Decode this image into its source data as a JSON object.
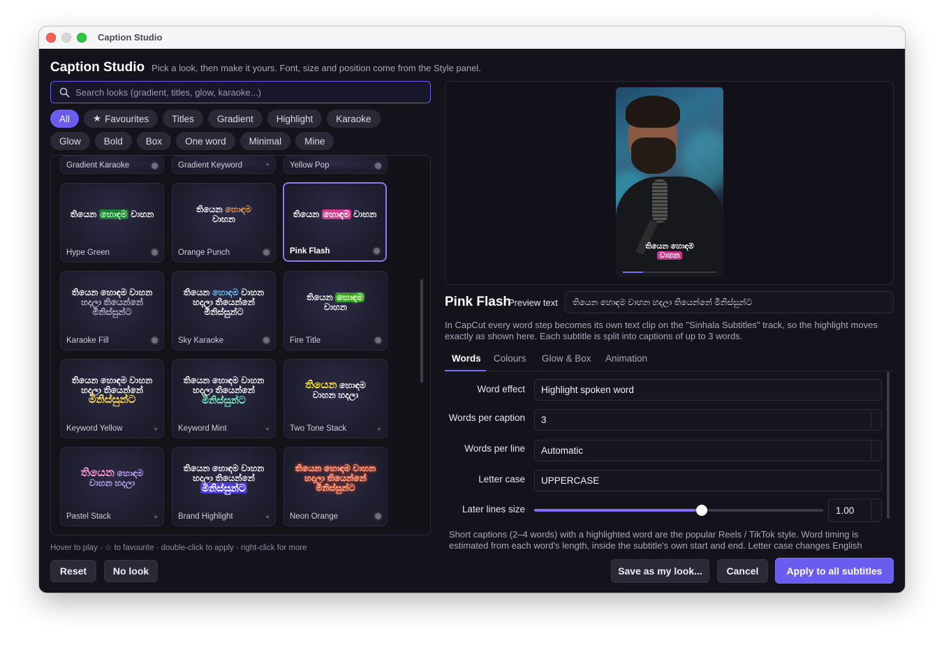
{
  "window": {
    "title": "Caption Studio"
  },
  "header": {
    "title": "Caption Studio",
    "subtitle": "Pick a look, then make it yours. Font, size and position come from the Style panel."
  },
  "search": {
    "placeholder": "Search looks (gradient, titles, glow, karaoke...)"
  },
  "filters": {
    "row1": [
      "All",
      "Favourites",
      "Titles",
      "Gradient",
      "Highlight",
      "Karaoke"
    ],
    "row2": [
      "Glow",
      "Bold",
      "Box",
      "One word",
      "Minimal",
      "Mine"
    ],
    "active": "All"
  },
  "looks": {
    "partial": [
      {
        "name": "Gradient Karaoke",
        "marker": "dot"
      },
      {
        "name": "Gradient Keyword",
        "marker": "+"
      },
      {
        "name": "Yellow Pop",
        "marker": "dot"
      }
    ],
    "items": [
      {
        "name": "Hype Green",
        "sample": "තියෙන හොඳම වාහන",
        "marker": "dot"
      },
      {
        "name": "Orange Punch",
        "sample": "තියෙන හොඳම වාහන",
        "marker": "dot"
      },
      {
        "name": "Pink Flash",
        "sample": "තියෙන හොඳම වාහන",
        "marker": "dot",
        "selected": true
      },
      {
        "name": "Karaoke Fill",
        "sample": "තියෙන හොඳම වාහන හදලා තියෙන්නේ මිනිස්සුන්ට",
        "marker": "dot"
      },
      {
        "name": "Sky Karaoke",
        "sample": "තියෙන හොඳම වාහන හදලා තියෙන්නේ මිනිස්සුන්ට",
        "marker": "dot"
      },
      {
        "name": "Fire Title",
        "sample": "තියෙන හොඳම වාහන",
        "marker": "dot"
      },
      {
        "name": "Keyword Yellow",
        "sample": "තියෙන හොඳම වාහන හදලා තියෙන්නේ මිනිස්සුන්ට",
        "marker": "+"
      },
      {
        "name": "Keyword Mint",
        "sample": "තියෙන හොඳම වාහන හදලා තියෙන්නේ මිනිස්සුන්ට",
        "marker": "+"
      },
      {
        "name": "Two Tone Stack",
        "sample": "තියෙන හොඳම වාහන හදලා",
        "marker": "+"
      },
      {
        "name": "Pastel Stack",
        "sample": "තියෙන හොඳම වාහන හදලා",
        "marker": "+"
      },
      {
        "name": "Brand Highlight",
        "sample": "තියෙන හොඳම වාහන හදලා තියෙන්නේ මිනිස්සුන්ට",
        "marker": "+"
      },
      {
        "name": "Neon Orange",
        "sample": "තියෙන හොඳම වාහන හදලා තියෙන්නේ මිනිස්සුන්ට",
        "marker": "dot"
      }
    ]
  },
  "hint": "Hover to play · ☆ to favourite · double-click to apply · right-click for more",
  "left_buttons": {
    "reset": "Reset",
    "no_look": "No look"
  },
  "preview": {
    "caption_line1": "තියෙන හොඳම",
    "caption_line2": "වාහන",
    "progress": 0.22
  },
  "style": {
    "name": "Pink Flash",
    "preview_text_label": "Preview text",
    "preview_text": "තියෙන හොඳම වාහන හදලා තියෙන්නේ මිනිස්සුන්ට"
  },
  "info": "In CapCut every word step becomes its own text clip on the \"Sinhala Subtitles\" track, so the highlight moves exactly as shown here. Each subtitle is split into captions of up to 3 words.",
  "tabs": [
    "Words",
    "Colours",
    "Glow & Box",
    "Animation"
  ],
  "active_tab": "Words",
  "form": {
    "word_effect": {
      "label": "Word effect",
      "value": "Highlight spoken word"
    },
    "words_per_caption": {
      "label": "Words per caption",
      "value": "3"
    },
    "words_per_line": {
      "label": "Words per line",
      "value": "Automatic"
    },
    "letter_case": {
      "label": "Letter case",
      "value": "UPPERCASE"
    },
    "later_lines_size": {
      "label": "Later lines size",
      "value": "1.00",
      "fraction": 0.58
    }
  },
  "footer_note": "Short captions (2–4 words) with a highlighted word are the popular Reels / TikTok style. Word timing is estimated from each word's length, inside the subtitle's own start and end. Letter case changes English",
  "buttons": {
    "save": "Save as my look...",
    "cancel": "Cancel",
    "apply": "Apply to all subtitles"
  },
  "colors": {
    "accent": "#6b5cf0",
    "background": "#14131c"
  }
}
